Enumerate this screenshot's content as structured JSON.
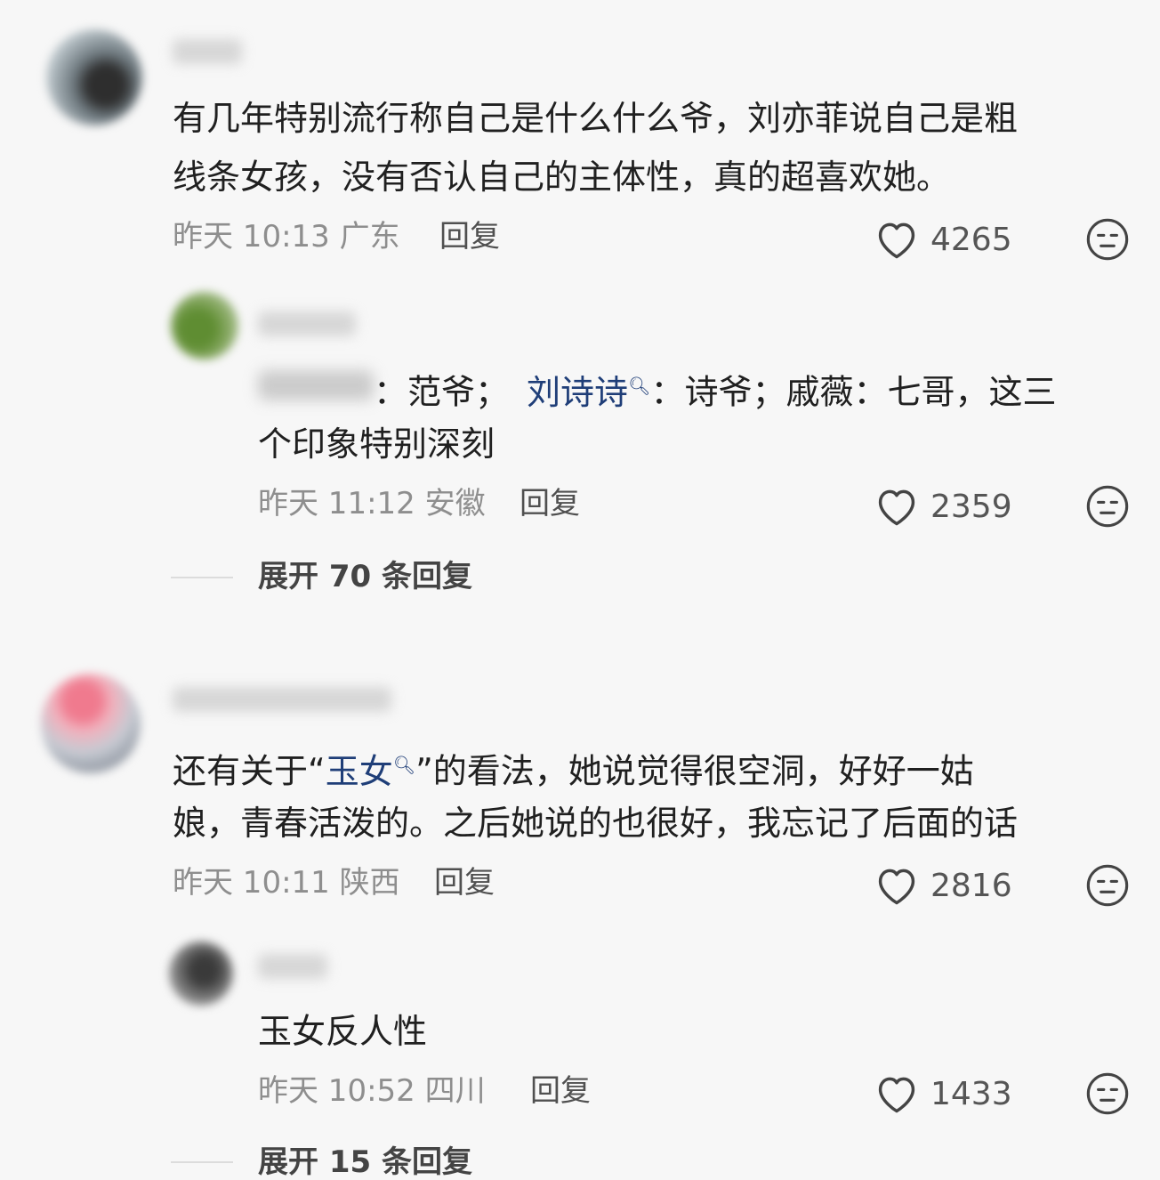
{
  "comments": [
    {
      "text_line1": "有几年特别流行称自己是什么什么爷，刘亦菲说自己是粗",
      "text_line2": "线条女孩，没有否认自己的主体性，真的超喜欢她。",
      "time": "昨天 10:13",
      "location": "广东",
      "reply_label": "回复",
      "likes": "4265",
      "replies": [
        {
          "mention_sep": "：",
          "text_a": "范爷；",
          "mention_name": "刘诗诗",
          "mention_icon": "search-icon",
          "text_b": "：诗爷；戚薇：七哥，这三",
          "text_line2": "个印象特别深刻",
          "time": "昨天 11:12",
          "location": "安徽",
          "reply_label": "回复",
          "likes": "2359"
        }
      ],
      "expand_label": "展开 70 条回复"
    },
    {
      "text_pre": "还有关于“",
      "mention_name": "玉女",
      "mention_icon": "search-icon",
      "text_post": "”的看法，她说觉得很空洞，好好一姑",
      "text_line2": "娘，青春活泼的。之后她说的也很好，我忘记了后面的话",
      "time": "昨天 10:11",
      "location": "陕西",
      "reply_label": "回复",
      "likes": "2816",
      "replies": [
        {
          "text": "玉女反人性",
          "time": "昨天 10:52",
          "location": "四川",
          "reply_label": "回复",
          "likes": "1433"
        }
      ],
      "expand_label": "展开 15 条回复"
    }
  ],
  "colors": {
    "mention": "#1f3e78",
    "meta": "#8e8e8e",
    "background": "#f7f7f7"
  },
  "icons": {
    "like": "heart-icon",
    "dislike": "meh-face-icon"
  }
}
